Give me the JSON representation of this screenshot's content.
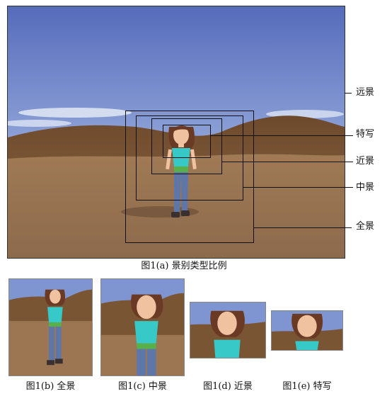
{
  "main": {
    "caption": "图1(a) 景别类型比例",
    "labels": {
      "far": "远景",
      "detail": "特写",
      "close": "近景",
      "medium": "中景",
      "full": "全景"
    }
  },
  "thumbnails": [
    {
      "caption": "图1(b) 全景"
    },
    {
      "caption": "图1(c) 中景"
    },
    {
      "caption": "图1(d) 近景"
    },
    {
      "caption": "图1(e) 特写"
    }
  ],
  "colors": {
    "sky_top": "#5e74c0",
    "sky_bottom": "#c6d3ee",
    "hill": "#7a5533",
    "ground": "#9c7653",
    "shirt": "#36c9c7",
    "jeans": "#5f77a8",
    "hair": "#6b3a24",
    "skin": "#f0c2a0"
  }
}
